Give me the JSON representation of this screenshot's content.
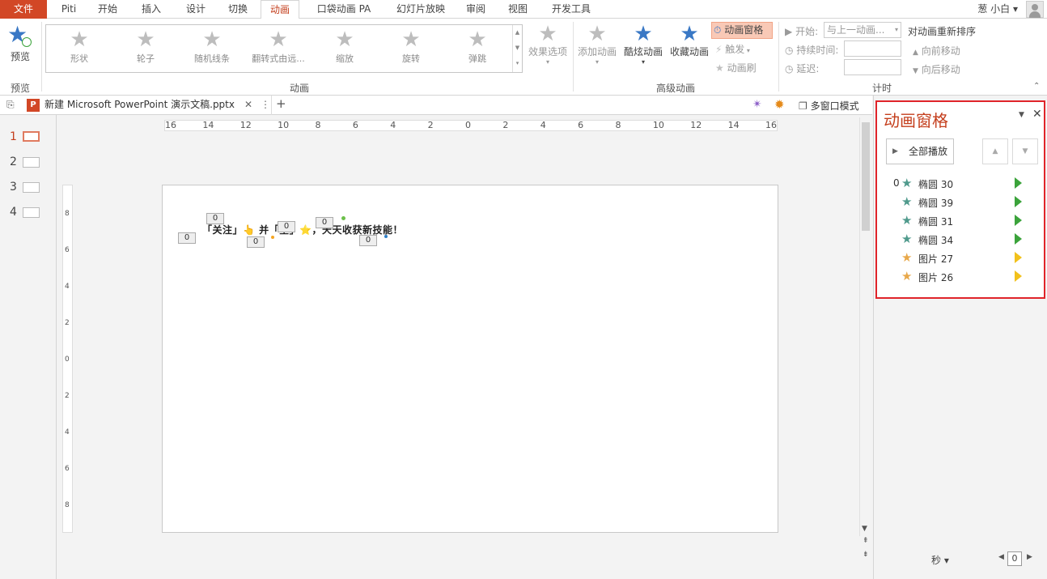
{
  "tabs": {
    "file": "文件",
    "piti": "Piti",
    "home": "开始",
    "insert": "插入",
    "design": "设计",
    "transitions": "切换",
    "animations": "动画",
    "pocket": "口袋动画 PA",
    "slideshow": "幻灯片放映",
    "review": "审阅",
    "view": "视图",
    "developer": "开发工具"
  },
  "user": {
    "name": "葱 小白 ▾"
  },
  "ribbon": {
    "preview": {
      "button": "预览",
      "group": "预览"
    },
    "animation_group": "动画",
    "gallery": [
      "形状",
      "轮子",
      "随机线条",
      "翻转式由远...",
      "缩放",
      "旋转",
      "弹跳"
    ],
    "effect_options": "效果选项",
    "advanced": {
      "add": "添加动画",
      "cool": "酷炫动画",
      "fav": "收藏动画",
      "pane": "动画窗格",
      "trigger": "触发",
      "painter": "动画刷",
      "group": "高级动画"
    },
    "timing": {
      "start_label": "开始:",
      "start_value": "与上一动画...",
      "duration_label": "持续时间:",
      "delay_label": "延迟:",
      "reorder": "对动画重新排序",
      "move_earlier": "向前移动",
      "move_later": "向后移动",
      "group": "计时"
    }
  },
  "document": {
    "tab_title": "新建 Microsoft PowerPoint 演示文稿.pptx",
    "multiwindow": "多窗口模式"
  },
  "slides": {
    "numbers": [
      "1",
      "2",
      "3",
      "4"
    ],
    "active": 1
  },
  "ruler": {
    "h_labels": [
      "16",
      "14",
      "12",
      "10",
      "8",
      "6",
      "4",
      "2",
      "0",
      "2",
      "4",
      "6",
      "8",
      "10",
      "12",
      "14",
      "16"
    ],
    "v_labels": [
      "8",
      "6",
      "4",
      "2",
      "0",
      "2",
      "4",
      "6",
      "8"
    ]
  },
  "slide": {
    "text": "「关注」👆 并「星」⭐，天天收获新技能！",
    "tags": [
      "0",
      "0",
      "0",
      "0",
      "0",
      "0"
    ]
  },
  "pane": {
    "title": "动画窗格",
    "play_all": "全部播放",
    "items": [
      {
        "idx": "0",
        "name": "椭圆 30",
        "kind": "green"
      },
      {
        "idx": "",
        "name": "椭圆 39",
        "kind": "green"
      },
      {
        "idx": "",
        "name": "椭圆 31",
        "kind": "green"
      },
      {
        "idx": "",
        "name": "椭圆 34",
        "kind": "green"
      },
      {
        "idx": "",
        "name": "图片 27",
        "kind": "yellow"
      },
      {
        "idx": "",
        "name": "图片 26",
        "kind": "yellow"
      }
    ],
    "seconds": "秒 ▾",
    "zoom": "0"
  },
  "colors": {
    "accent": "#c43e1c",
    "file_tab": "#d24726",
    "pane_border": "#e0242a"
  }
}
